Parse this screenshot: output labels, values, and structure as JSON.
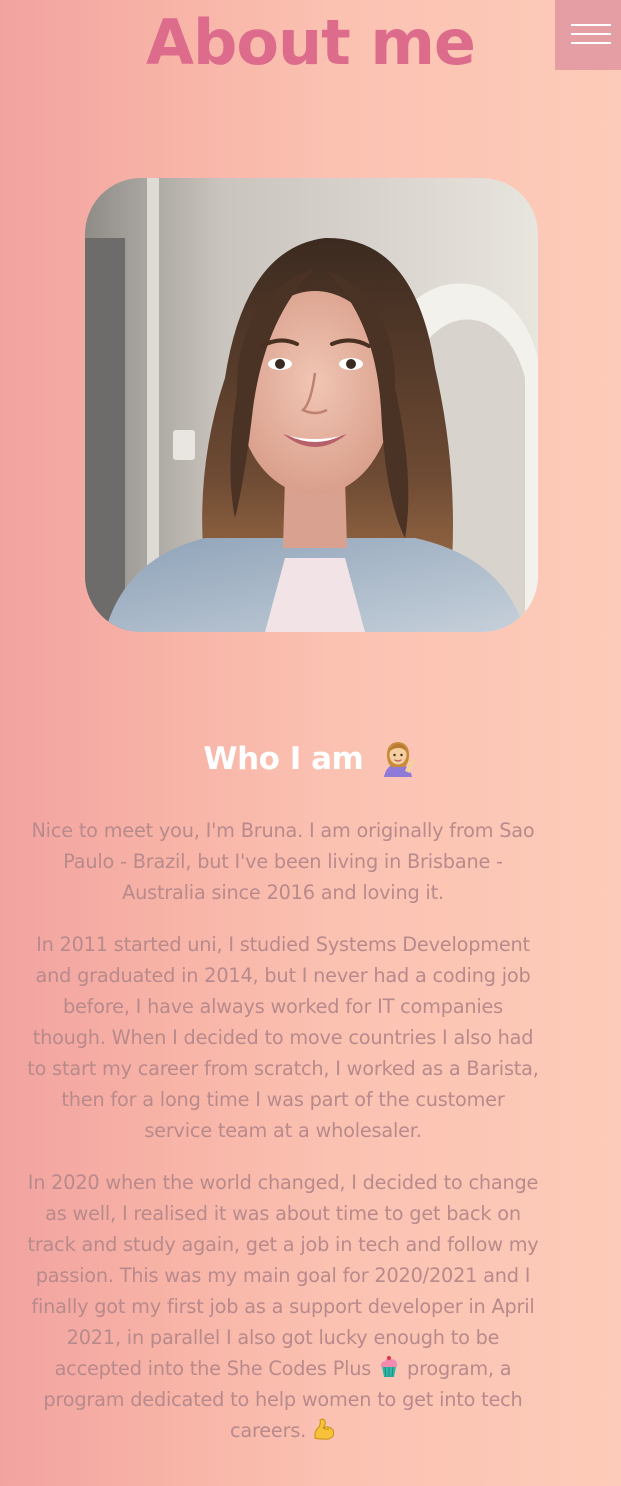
{
  "header": {
    "title": "About me"
  },
  "menu": {
    "label": ""
  },
  "photo": {
    "alt": "Profile photo"
  },
  "about": {
    "heading": "Who I am",
    "paragraph_1": "Nice to meet you, I'm Bruna. I am originally from Sao Paulo - Brazil, but I've been living in Brisbane - Australia since 2016 and loving it.",
    "paragraph_2": "In 2011 started uni, I studied Systems Development and graduated in 2014, but I never had a coding job before, I have always worked for IT companies though. When I decided to move countries I also had to start my career from scratch, I worked as a Barista, then for a long time I was part of the customer service team at a wholesaler.",
    "paragraph_3_before": "In 2020 when the world changed, I decided to change as well, I realised it was about time to get back on track and study again, get a job in tech and follow my passion. This was my main goal for 2020/2021 and I finally got my first job as a support developer in April 2021, in parallel I also got lucky enough to be accepted into the She Codes Plus",
    "paragraph_3_after": "program, a program dedicated to help women to get into tech careers."
  },
  "icons": {
    "menu": "hamburger-icon",
    "heading_emoji": "woman-tipping-hand-icon",
    "cupcake": "cupcake-icon",
    "muscle": "flexed-biceps-icon"
  },
  "colors": {
    "title": "#dd6c8c",
    "menu_bg": "#e59ea4",
    "text": "#b98a8c",
    "heading": "#ffffff"
  }
}
